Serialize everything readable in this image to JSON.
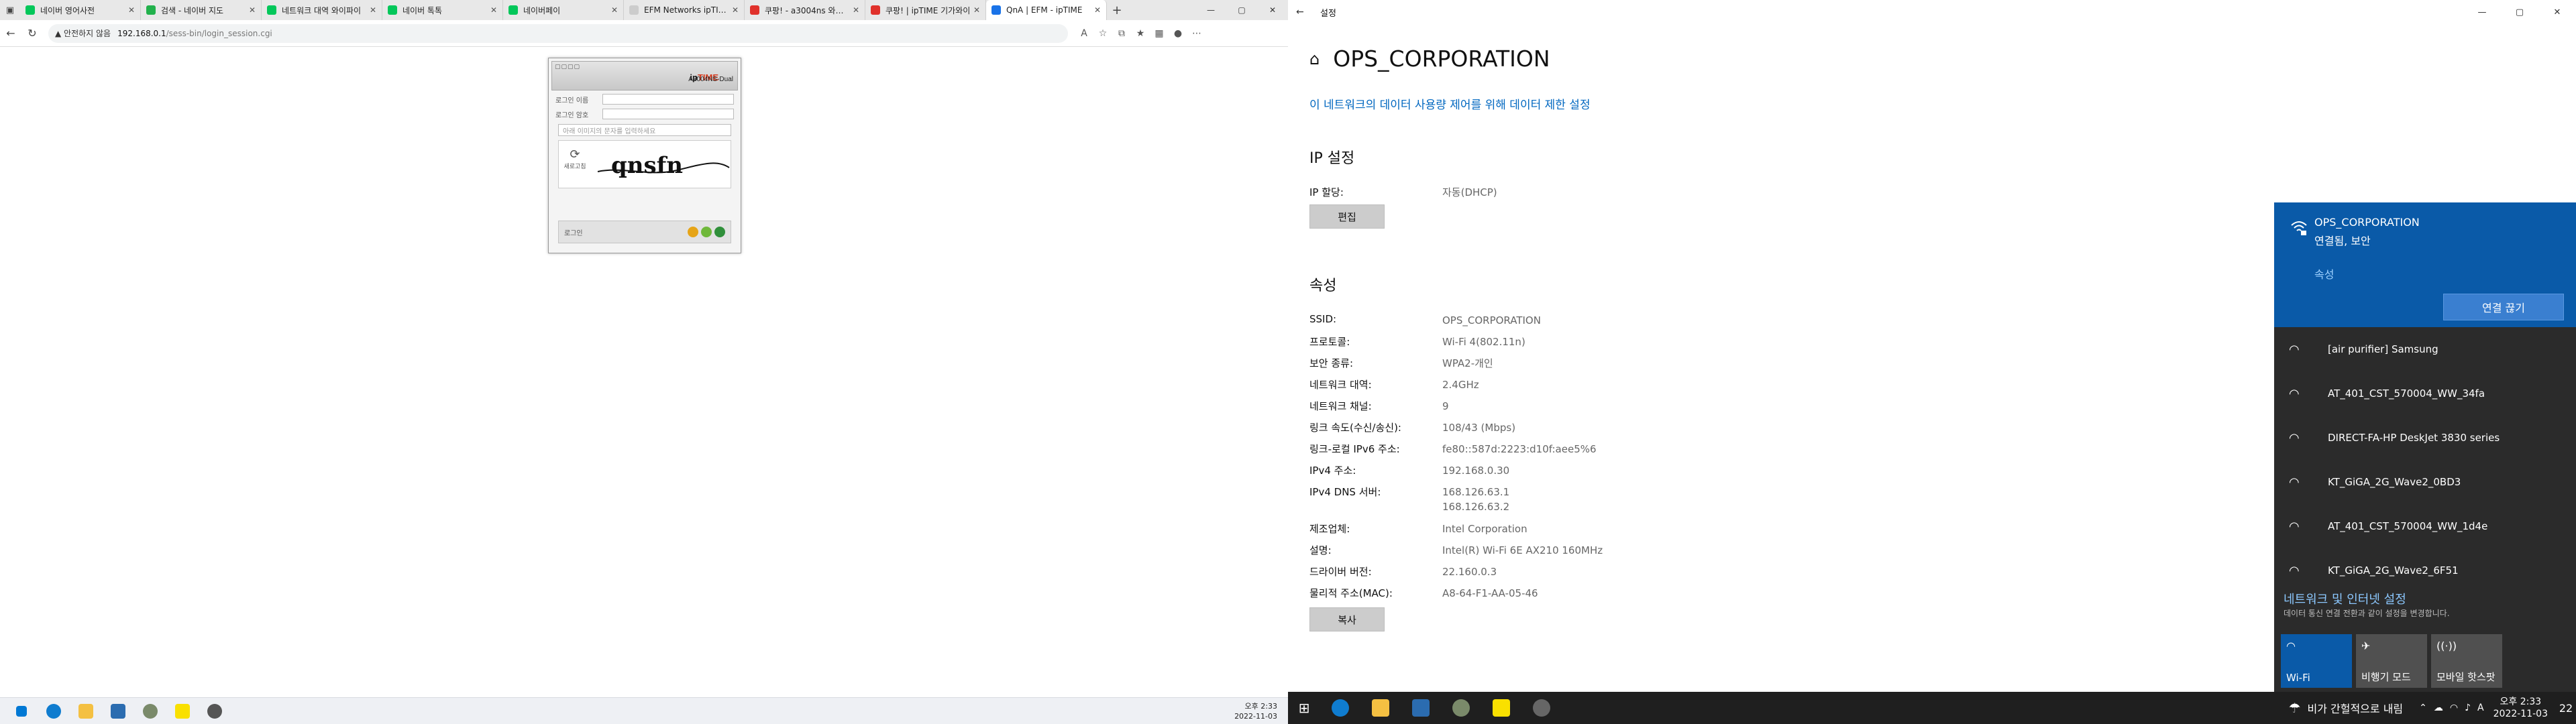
{
  "browser": {
    "tabs": [
      {
        "title": "네이버 영어사전",
        "favicon_color": "#03c75a",
        "active": false
      },
      {
        "title": "검색 - 네이버 지도",
        "favicon_color": "#22b14c",
        "active": false
      },
      {
        "title": "네트워크 대역 와이파이",
        "favicon_color": "#03c75a",
        "active": false
      },
      {
        "title": "네이버 톡톡",
        "favicon_color": "#03c75a",
        "active": false
      },
      {
        "title": "네이버페이",
        "favicon_color": "#03c75a",
        "active": false
      },
      {
        "title": "EFM Networks ipTIME",
        "favicon_color": "#cccccc",
        "active": false
      },
      {
        "title": "쿠팡! - a3004ns 와이파이",
        "favicon_color": "#e0312b",
        "active": false
      },
      {
        "title": "쿠팡! | ipTIME 기가와이",
        "favicon_color": "#e0312b",
        "active": false
      },
      {
        "title": "QnA | EFM - ipTIME",
        "favicon_color": "#1a73e8",
        "active": true
      }
    ],
    "address": {
      "security_warning": "▲ 안전하지 않음",
      "host": "192.168.0.1",
      "path": "/sess-bin/login_session.cgi"
    },
    "login": {
      "brand_ip": "ip",
      "brand_time": "TIME",
      "model": "A3004NS-Dual",
      "header_dots": "▢▢▢▢",
      "id_label": "로그인 이름",
      "pw_label": "로그인 암호",
      "captcha_hint": "아래 이미지의 문자를 입력하세요",
      "refresh_label": "새로고침",
      "captcha_text": "qnsfn",
      "login_label": "로그인"
    }
  },
  "taskbar_left": {
    "time": "오후 2:33",
    "date": "2022-11-03"
  },
  "settings": {
    "window_title": "설정",
    "network_name": "OPS_CORPORATION",
    "data_limit_link": "이 네트워크의 데이터 사용량 제어를 위해 데이터 제한 설정",
    "ip_section": "IP 설정",
    "ip_assign_label": "IP 할당:",
    "ip_assign_value": "자동(DHCP)",
    "edit_button": "편집",
    "props_section": "속성",
    "properties": [
      {
        "k": "SSID:",
        "v": "OPS_CORPORATION"
      },
      {
        "k": "프로토콜:",
        "v": "Wi-Fi 4(802.11n)"
      },
      {
        "k": "보안 종류:",
        "v": "WPA2-개인"
      },
      {
        "k": "네트워크 대역:",
        "v": "2.4GHz"
      },
      {
        "k": "네트워크 채널:",
        "v": "9"
      },
      {
        "k": "링크 속도(수신/송신):",
        "v": "108/43 (Mbps)"
      },
      {
        "k": "링크-로컬 IPv6 주소:",
        "v": "fe80::587d:2223:d10f:aee5%6"
      },
      {
        "k": "IPv4 주소:",
        "v": "192.168.0.30"
      },
      {
        "k": "IPv4 DNS 서버:",
        "v": "168.126.63.1",
        "v2": "168.126.63.2"
      },
      {
        "k": "제조업체:",
        "v": "Intel Corporation"
      },
      {
        "k": "설명:",
        "v": "Intel(R) Wi-Fi 6E AX210 160MHz"
      },
      {
        "k": "드라이버 버전:",
        "v": "22.160.0.3"
      },
      {
        "k": "물리적 주소(MAC):",
        "v": "A8-64-F1-AA-05-46"
      }
    ],
    "copy_button": "복사"
  },
  "flyout": {
    "connected_name": "OPS_CORPORATION",
    "connected_status": "연결됨, 보안",
    "properties_link": "속성",
    "disconnect_button": "연결 끊기",
    "networks": [
      "[air purifier] Samsung",
      "AT_401_CST_570004_WW_34fa",
      "DIRECT-FA-HP DeskJet 3830 series",
      "KT_GiGA_2G_Wave2_0BD3",
      "AT_401_CST_570004_WW_1d4e",
      "KT_GiGA_2G_Wave2_6F51"
    ],
    "net_settings_title": "네트워크 및 인터넷 설정",
    "net_settings_sub": "데이터 통신 연결 전환과 같이 설정을 변경합니다.",
    "quick": {
      "wifi": "Wi-Fi",
      "airplane": "비행기 모드",
      "hotspot": "모바일 핫스팟"
    }
  },
  "taskbar_right": {
    "weather": "비가 간헐적으로 내림",
    "ime": "A",
    "time": "오후 2:33",
    "date": "2022-11-03",
    "notif_count": "22"
  }
}
